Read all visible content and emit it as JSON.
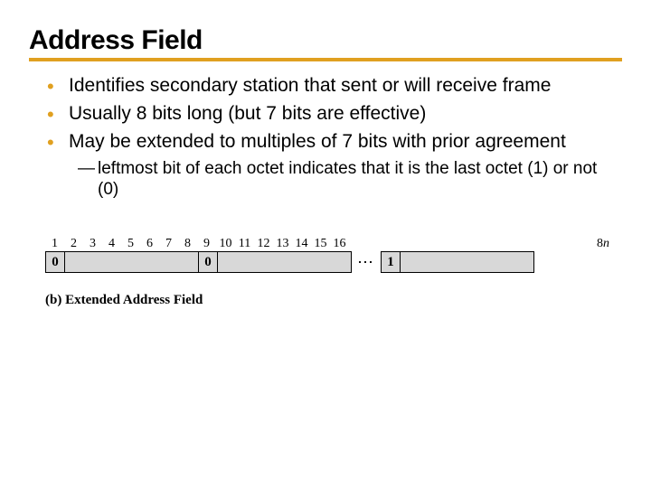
{
  "title": "Address Field",
  "bullets": [
    "Identifies secondary station that sent or will receive frame",
    "Usually 8 bits long (but 7 bits are effective)",
    "May be extended to multiples of 7 bits with prior agreement"
  ],
  "subbullet": "leftmost bit of each octet indicates that it is the last octet (1) or not (0)",
  "diagram": {
    "bit_labels_1": [
      "1",
      "2",
      "3",
      "4",
      "5",
      "6",
      "7",
      "8"
    ],
    "bit_labels_2": [
      "9",
      "10",
      "11",
      "12",
      "13",
      "14",
      "15",
      "16"
    ],
    "last_label_prefix": "8",
    "last_label_var": "n",
    "first_bit_a": "0",
    "first_bit_b": "0",
    "first_bit_last": "1",
    "dots": "⋯"
  },
  "caption_label": "(b)",
  "caption_text": "Extended Address Field"
}
